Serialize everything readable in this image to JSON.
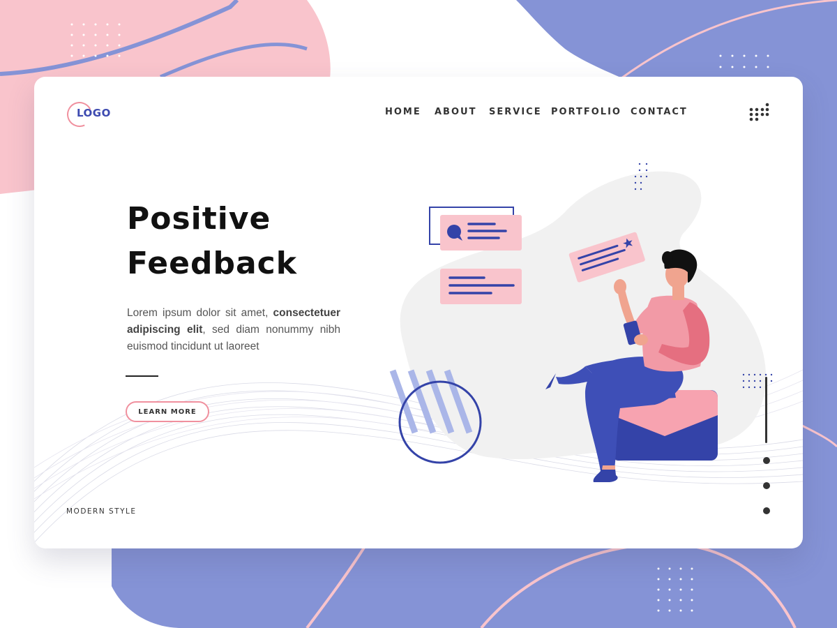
{
  "header": {
    "logo_text": "LOGO",
    "nav": [
      {
        "label": "HOME"
      },
      {
        "label": "ABOUT"
      },
      {
        "label": "SERVICE"
      },
      {
        "label": "PORTFOLIO"
      },
      {
        "label": "CONTACT"
      }
    ],
    "menu_icon": "dots-grid-icon"
  },
  "hero": {
    "title_line1": "Positive",
    "title_line2": "Feedback",
    "desc_part1": "Lorem ipsum dolor sit amet, ",
    "desc_bold": "consectetuer adipiscing elit",
    "desc_part2": ", sed diam nonummy nibh euismod tincidunt ut laoreet",
    "button_label": "LEARN MORE"
  },
  "footer": {
    "tagline": "MODERN STYLE"
  },
  "illustration": {
    "name": "person-with-feedback-cards",
    "icons": [
      "chat-bubble-icon",
      "star-icon"
    ]
  },
  "pager": {
    "dots": 3,
    "active": 0
  },
  "colors": {
    "pink": "#f9c4cc",
    "pink_dark": "#f0909e",
    "blue": "#8593d6",
    "navy": "#3443a8",
    "text": "#111111"
  }
}
